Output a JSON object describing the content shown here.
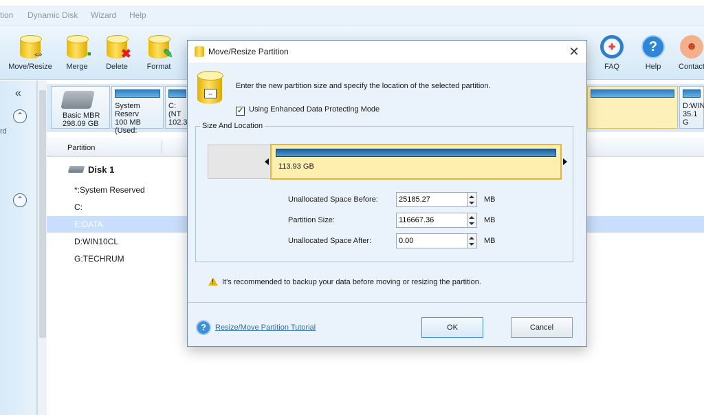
{
  "menu": [
    "tion",
    "Dynamic Disk",
    "Wizard",
    "Help"
  ],
  "toolbar": {
    "move_resize": "Move/Resize",
    "merge": "Merge",
    "delete": "Delete",
    "format": "Format",
    "faq": "FAQ",
    "help": "Help",
    "contact": "Contact"
  },
  "leftpanel": {
    "collapse_glyph": "«",
    "partial_text": "rd"
  },
  "diskmap": {
    "disk_label": "Basic MBR",
    "disk_size": "298.09 GB",
    "part1_name": "System Reserv",
    "part1_info": "100 MB (Used:",
    "part2_name": "C:(NT",
    "part2_info": "102.3",
    "part_last_name": "D:WIN",
    "part_last_info": "35.1 G"
  },
  "list": {
    "header_partition": "Partition",
    "disk_name": "Disk 1",
    "rows": [
      "*:System Reserved",
      "C:",
      "E:DATA",
      "D:WIN10CL",
      "G:TECHRUM"
    ]
  },
  "dialog": {
    "title": "Move/Resize Partition",
    "close_glyph": "✕",
    "instruction": "Enter the new partition size and specify the location of the selected partition.",
    "checkbox_label": "Using Enhanced Data Protecting Mode",
    "checkbox_checked": true,
    "group_title": "Size And Location",
    "partition_size_display": "113.93 GB",
    "fields": {
      "before_label": "Unallocated Space Before:",
      "before_value": "25185.27",
      "size_label": "Partition Size:",
      "size_value": "116667.36",
      "after_label": "Unallocated Space After:",
      "after_value": "0.00",
      "unit": "MB"
    },
    "warning": "It's recommended to backup your data before moving or resizing the partition.",
    "tutorial_link": "Resize/Move Partition Tutorial",
    "ok_label": "OK",
    "cancel_label": "Cancel"
  },
  "colors": {
    "accent": "#3d8fd6",
    "selected_partition": "#ffefae",
    "partition_border": "#e7b442"
  }
}
